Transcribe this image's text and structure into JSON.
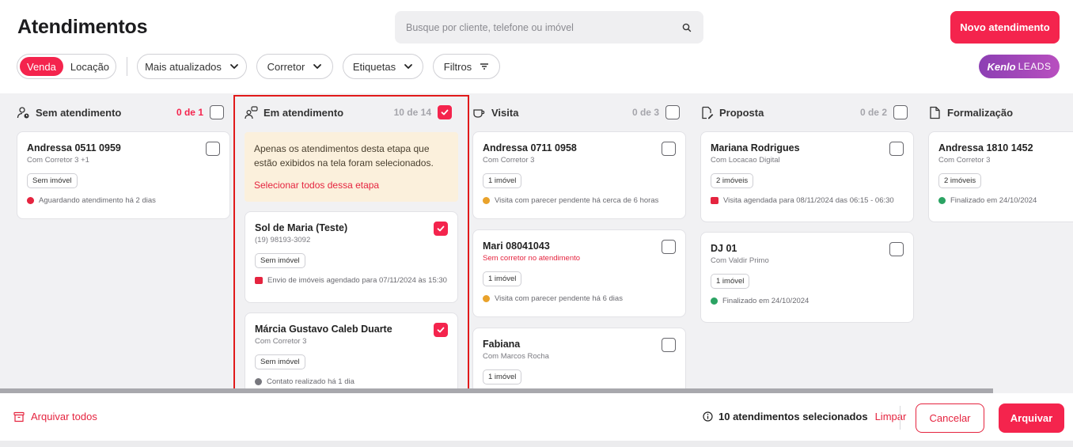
{
  "header": {
    "title": "Atendimentos",
    "search_placeholder": "Busque por cliente, telefone ou imóvel",
    "new_button": "Novo atendimento"
  },
  "filters": {
    "segment": [
      "Venda",
      "Locação"
    ],
    "sort": "Mais atualizados",
    "broker": "Corretor",
    "tags": "Etiquetas",
    "filters": "Filtros",
    "brand": {
      "name": "Kenlo",
      "suffix": "LEADS"
    }
  },
  "columns": [
    {
      "title": "Sem atendimento",
      "count": "0 de 1",
      "cards": [
        {
          "name": "Andressa 0511 0959",
          "sub": "Com Corretor 3 +1",
          "tag": "Sem imóvel",
          "status": "Aguardando atendimento há 2 dias"
        }
      ]
    },
    {
      "title": "Em atendimento",
      "count": "10 de 14",
      "note": "Apenas os atendimentos desta etapa que estão exibidos na tela foram selecionados.",
      "note_link": "Selecionar todos dessa etapa",
      "cards": [
        {
          "name": "Sol de Maria (Teste)",
          "sub": "(19) 98193-3092",
          "tag": "Sem imóvel",
          "status": "Envio de imóveis agendado para 07/11/2024 às 15:30"
        },
        {
          "name": "Márcia Gustavo Caleb Duarte",
          "sub": "Com Corretor 3",
          "tag": "Sem imóvel",
          "status": "Contato realizado há 1 dia"
        }
      ]
    },
    {
      "title": "Visita",
      "count": "0 de 3",
      "cards": [
        {
          "name": "Andressa 0711 0958",
          "sub": "Com Corretor 3",
          "tag": "1 imóvel",
          "status": "Visita com parecer pendente há cerca de 6 horas"
        },
        {
          "name": "Mari 08041043",
          "sub": "Sem corretor no atendimento",
          "tag": "1 imóvel",
          "status": "Visita com parecer pendente há 6 dias"
        },
        {
          "name": "Fabiana",
          "sub": "Com Marcos Rocha",
          "tag": "1 imóvel"
        }
      ]
    },
    {
      "title": "Proposta",
      "count": "0 de 2",
      "cards": [
        {
          "name": "Mariana Rodrigues",
          "sub": "Com Locacao Digital",
          "tag": "2 imóveis",
          "status": "Visita agendada para 08/11/2024 das 06:15 - 06:30"
        },
        {
          "name": "DJ 01",
          "sub": "Com Valdir Primo",
          "tag": "1 imóvel",
          "status": "Finalizado em 24/10/2024"
        }
      ]
    },
    {
      "title": "Formalização",
      "cards": [
        {
          "name": "Andressa 1810 1452",
          "sub": "Com Corretor 3",
          "tag": "2 imóveis",
          "status": "Finalizado em 24/10/2024"
        }
      ]
    }
  ],
  "footer": {
    "archive_all": "Arquivar todos",
    "selected_text": "10 atendimentos selecionados",
    "clear": "Limpar",
    "cancel": "Cancelar",
    "archive": "Arquivar"
  },
  "colors": {
    "accent": "#f4244d",
    "highlight": "#e11a1a",
    "note_bg": "#fbf0dc"
  }
}
